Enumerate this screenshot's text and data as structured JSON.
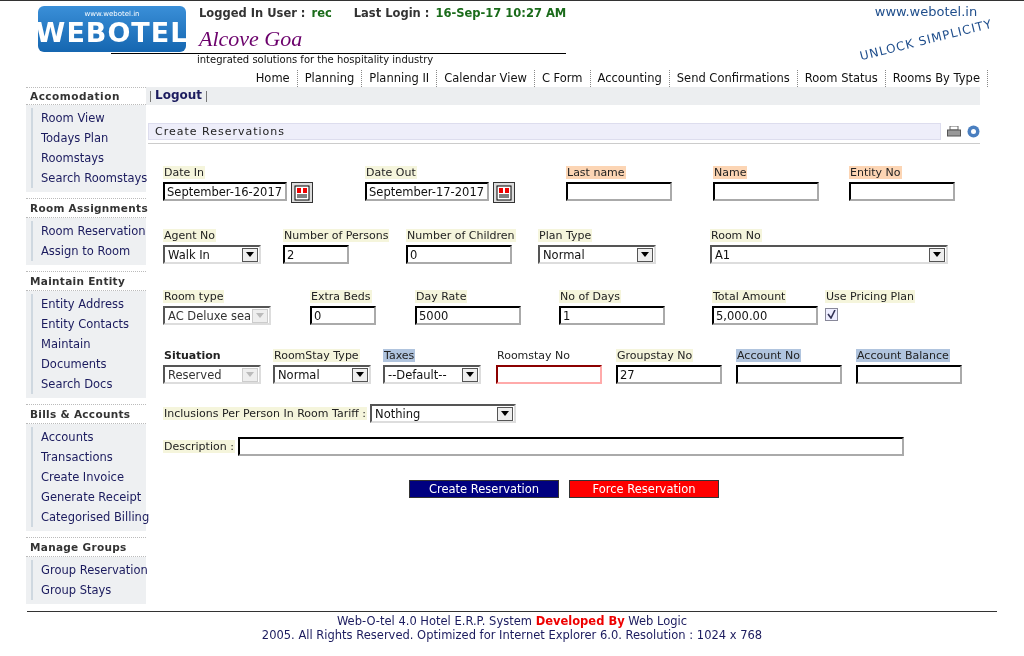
{
  "header": {
    "logo": "WEBOTEL",
    "logo_url": "www.webotel.in",
    "logged_in_label": "Logged In User :",
    "user": "rec",
    "last_login_label": "Last Login :",
    "last_login": "16-Sep-17 10:27 AM",
    "hotel": "Alcove Goa",
    "tagline": "integrated solutions for the hospitality industry",
    "site": "www.webotel.in",
    "slogan": "UNLOCK SIMPLICITY"
  },
  "nav": [
    "Home",
    "Planning",
    "Planning II",
    "Calendar View",
    "C Form",
    "Accounting",
    "Send Confirmations",
    "Room Status",
    "Rooms By Type"
  ],
  "logout": "Logout",
  "sidebar": [
    {
      "title": "Accomodation",
      "items": [
        "Room View",
        "Todays Plan",
        "Roomstays",
        "Search Roomstays"
      ]
    },
    {
      "title": "Room Assignments",
      "items": [
        "Room Reservation",
        "Assign to Room"
      ]
    },
    {
      "title": "Maintain Entity",
      "items": [
        "Entity Address",
        "Entity Contacts",
        "Maintain",
        "Documents",
        "Search Docs"
      ]
    },
    {
      "title": "Bills & Accounts",
      "items": [
        "Accounts",
        "Transactions",
        "Create Invoice",
        "Generate Receipt",
        "Categorised Billing"
      ]
    },
    {
      "title": "Manage Groups",
      "items": [
        "Group Reservation",
        "Group Stays"
      ]
    }
  ],
  "page_title": "Create Reservations",
  "form_rows": [
    [
      {
        "label": "Date In",
        "color": "#f5f5dc",
        "bold": false,
        "kind": "date",
        "value": "September-16-2017"
      },
      {
        "label": "Date Out",
        "color": "#f5f5dc",
        "bold": false,
        "kind": "date",
        "value": "September-17-2017"
      },
      {
        "label": "Last name",
        "color": "#fcd5b4",
        "bold": false,
        "kind": "text",
        "invalid": false
      },
      {
        "label": "Name",
        "color": "#fcd5b4",
        "bold": false,
        "kind": "text",
        "invalid": false
      },
      {
        "label": "Entity No",
        "color": "#fcd5b4",
        "bold": false,
        "kind": "text",
        "invalid": false
      }
    ],
    [
      {
        "label": "Agent No",
        "color": "#f5f5dc",
        "bold": false,
        "kind": "select",
        "value": "Walk In",
        "disabled": false
      },
      {
        "label": "Number of Persons",
        "color": "#f5f5dc",
        "bold": false,
        "kind": "text",
        "value": "2",
        "invalid": false
      },
      {
        "label": "Number of Children",
        "color": "#f5f5dc",
        "bold": false,
        "kind": "text",
        "value": "0",
        "invalid": false
      },
      {
        "label": "Plan Type",
        "color": "#f5f5dc",
        "bold": false,
        "kind": "select",
        "value": "Normal",
        "disabled": false
      },
      {
        "label": "Room No",
        "color": "#f5f5dc",
        "bold": false,
        "kind": "select",
        "value": "A1",
        "disabled": false
      }
    ],
    [
      {
        "label": "Room type",
        "color": "#f5f5dc",
        "bold": false,
        "kind": "select",
        "value": "AC Deluxe sea",
        "disabled": true
      },
      {
        "label": "Extra Beds",
        "color": "#f5f5dc",
        "bold": false,
        "kind": "text",
        "value": "0",
        "invalid": false
      },
      {
        "label": "Day Rate",
        "color": "#f5f5dc",
        "bold": false,
        "kind": "text",
        "value": "5000",
        "invalid": false
      },
      {
        "label": "No of Days",
        "color": "#f5f5dc",
        "bold": false,
        "kind": "text",
        "value": "1",
        "invalid": false
      },
      {
        "label": "Total Amount",
        "color": "#f5f5dc",
        "bold": false,
        "kind": "text",
        "value": "5,000.00",
        "invalid": false
      },
      {
        "label": "Use Pricing Plan",
        "color": "#f5f5dc",
        "bold": false,
        "kind": "checkbox",
        "checked": true
      }
    ],
    [
      {
        "label": "Situation",
        "color": "#ffffff",
        "bold": true,
        "kind": "select",
        "value": "Reserved",
        "disabled": true
      },
      {
        "label": "RoomStay Type",
        "color": "#f5f5dc",
        "bold": false,
        "kind": "select",
        "value": "Normal",
        "disabled": false
      },
      {
        "label": "Taxes",
        "color": "#b0c4de",
        "bold": false,
        "kind": "select",
        "value": "--Default--",
        "disabled": false
      },
      {
        "label": "Roomstay No",
        "color": "#ffffff",
        "bold": false,
        "kind": "text",
        "invalid": true
      },
      {
        "label": "Groupstay No",
        "color": "#f5f5dc",
        "bold": false,
        "kind": "text",
        "value": "27",
        "invalid": false
      },
      {
        "label": "Account No",
        "color": "#b0c4de",
        "bold": false,
        "kind": "text",
        "invalid": false
      },
      {
        "label": "Account Balance",
        "color": "#b0c4de",
        "bold": false,
        "kind": "text",
        "invalid": false
      }
    ]
  ],
  "inclusions": {
    "label": "Inclusions Per Person In Room Tariff :",
    "value": "Nothing"
  },
  "description": {
    "label": "Description :"
  },
  "buttons": [
    {
      "label": "Create Reservation",
      "kind": "primary"
    },
    {
      "label": "Force Reservation",
      "kind": "danger"
    }
  ],
  "footer": {
    "line1_start": "Web-O-tel 4.0 Hotel E.R.P. System",
    "developed_by": "Developed By",
    "company": "Web Logic",
    "line2": "2005. All Rights Reserved. Optimized for Internet Explorer 6.0.  Resolution : 1024 x 768"
  }
}
